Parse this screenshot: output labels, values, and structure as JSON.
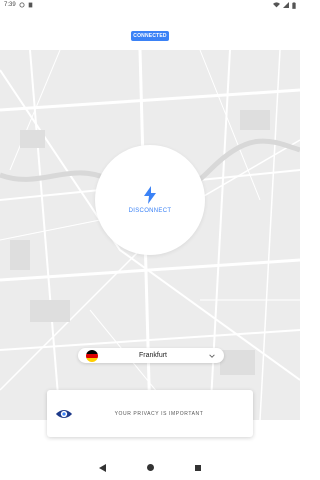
{
  "status_bar": {
    "time": "7:39"
  },
  "connection": {
    "badge": "CONNECTED"
  },
  "disconnect": {
    "label": "DISCONNECT"
  },
  "server": {
    "name": "Frankfurt"
  },
  "privacy": {
    "text": "YOUR PRIVACY IS IMPORTANT"
  },
  "colors": {
    "accent": "#3b82f6",
    "map": "#ececec"
  },
  "icons": [
    "lightning-bolt-icon",
    "germany-flag-icon",
    "chevron-down-icon",
    "eye-icon",
    "back-icon",
    "home-icon",
    "recents-icon"
  ]
}
